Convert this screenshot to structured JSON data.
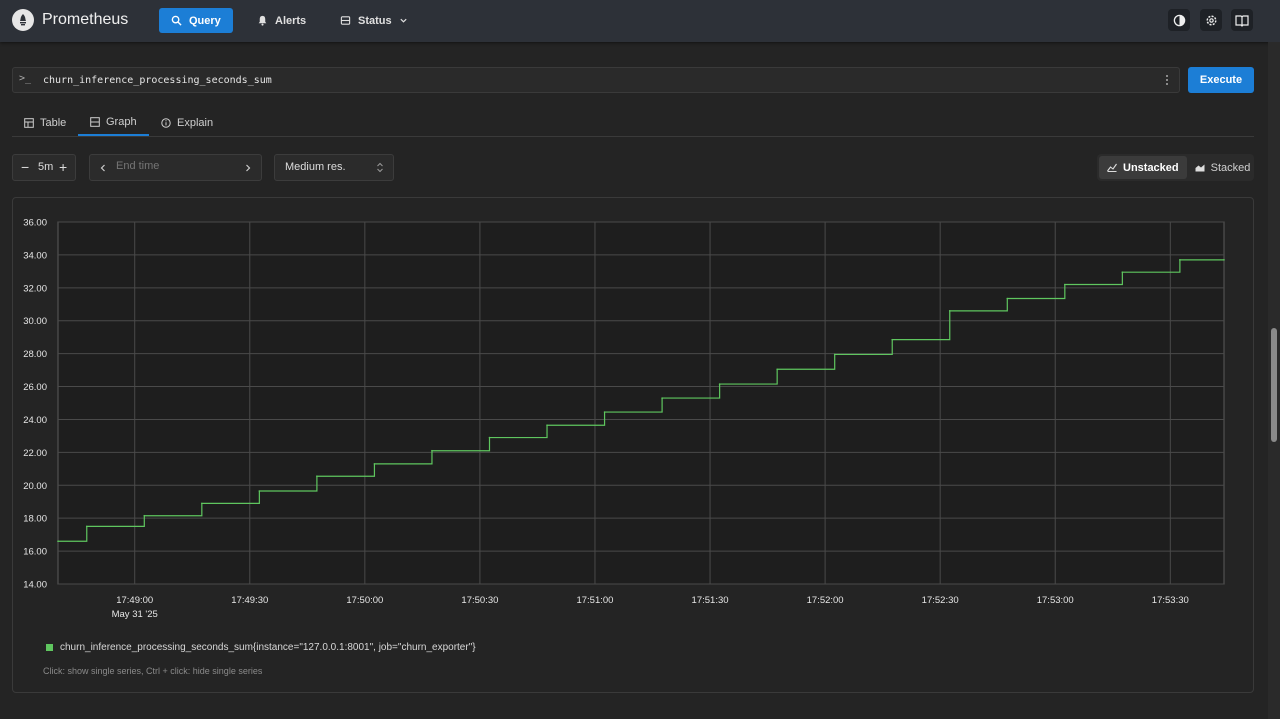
{
  "app": {
    "name": "Prometheus"
  },
  "nav": {
    "query": "Query",
    "alerts": "Alerts",
    "status": "Status"
  },
  "query": {
    "expression": "churn_inference_processing_seconds_sum",
    "execute_label": "Execute"
  },
  "tabs": {
    "table": "Table",
    "graph": "Graph",
    "explain": "Explain"
  },
  "controls": {
    "range": "5m",
    "end_time_placeholder": "End time",
    "resolution": "Medium res.",
    "unstacked": "Unstacked",
    "stacked": "Stacked"
  },
  "colors": {
    "accent": "#1c7ed6",
    "series": "#5fc65f"
  },
  "legend": {
    "series_label": "churn_inference_processing_seconds_sum{instance=\"127.0.0.1:8001\", job=\"churn_exporter\"}",
    "hint": "Click: show single series, Ctrl + click: hide single series"
  },
  "chart_data": {
    "type": "line",
    "step": true,
    "xlim_seconds": [
      22,
      326
    ],
    "ylim": [
      14,
      36
    ],
    "y_ticks": [
      14,
      16,
      18,
      20,
      22,
      24,
      26,
      28,
      30,
      32,
      34,
      36
    ],
    "y_tick_labels": [
      "14.00",
      "16.00",
      "18.00",
      "20.00",
      "22.00",
      "24.00",
      "26.00",
      "28.00",
      "30.00",
      "32.00",
      "34.00",
      "36.00"
    ],
    "x_ticks_seconds": [
      42,
      72,
      102,
      132,
      162,
      192,
      222,
      252,
      282,
      312
    ],
    "x_tick_labels": [
      "17:49:00",
      "17:49:30",
      "17:50:00",
      "17:50:30",
      "17:51:00",
      "17:51:30",
      "17:52:00",
      "17:52:30",
      "17:53:00",
      "17:53:30"
    ],
    "x_date_label": "May 31 '25",
    "grid": true,
    "series": [
      {
        "name": "churn_inference_processing_seconds_sum{instance=\"127.0.0.1:8001\", job=\"churn_exporter\"}",
        "x_seconds": [
          22,
          29.5,
          44.5,
          59.5,
          74.5,
          89.5,
          104.5,
          119.5,
          134.5,
          149.5,
          164.5,
          179.5,
          194.5,
          209.5,
          224.5,
          239.5,
          254.5,
          269.5,
          284.5,
          299.5,
          314.5,
          326
        ],
        "values": [
          16.6,
          17.5,
          18.15,
          18.9,
          19.65,
          20.55,
          21.3,
          22.1,
          22.9,
          23.65,
          24.45,
          25.3,
          26.15,
          27.05,
          27.95,
          28.85,
          30.6,
          31.35,
          32.2,
          32.95,
          33.7,
          33.7
        ]
      }
    ]
  }
}
